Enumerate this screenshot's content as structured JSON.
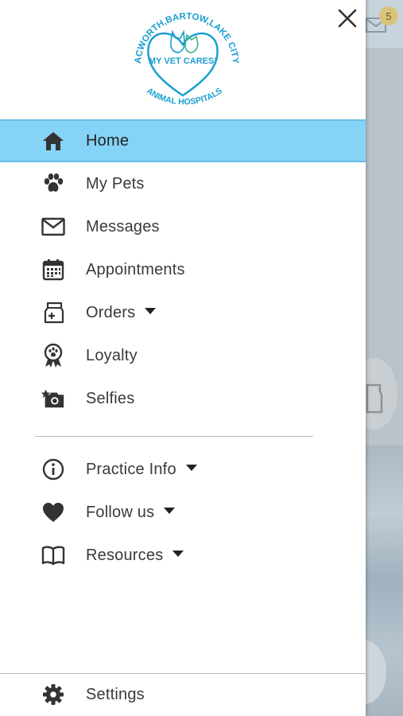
{
  "logo": {
    "arc_text": "ACWORTH,BARTOW,LAKE CITY",
    "center_text": "MY VET CARES!",
    "bottom_text": "ANIMAL HOSPITALS",
    "brand_color": "#1a9fd0"
  },
  "drawer": {
    "close_icon": "close-icon",
    "menu": [
      {
        "label": "Home",
        "icon": "home-icon",
        "active": true
      },
      {
        "label": "My Pets",
        "icon": "paw-icon"
      },
      {
        "label": "Messages",
        "icon": "envelope-icon"
      },
      {
        "label": "Appointments",
        "icon": "calendar-icon"
      },
      {
        "label": "Orders",
        "icon": "medicine-bag-icon",
        "expandable": true
      },
      {
        "label": "Loyalty",
        "icon": "award-ribbon-icon"
      },
      {
        "label": "Selfies",
        "icon": "camera-icon"
      }
    ],
    "secondary_menu": [
      {
        "label": "Practice Info",
        "icon": "info-icon",
        "expandable": true
      },
      {
        "label": "Follow us",
        "icon": "heart-icon",
        "expandable": true
      },
      {
        "label": "Resources",
        "icon": "book-icon",
        "expandable": true
      }
    ],
    "settings": {
      "label": "Settings",
      "icon": "gear-icon"
    }
  },
  "background": {
    "notification_count": "5",
    "active_color": "#85d3f7"
  }
}
